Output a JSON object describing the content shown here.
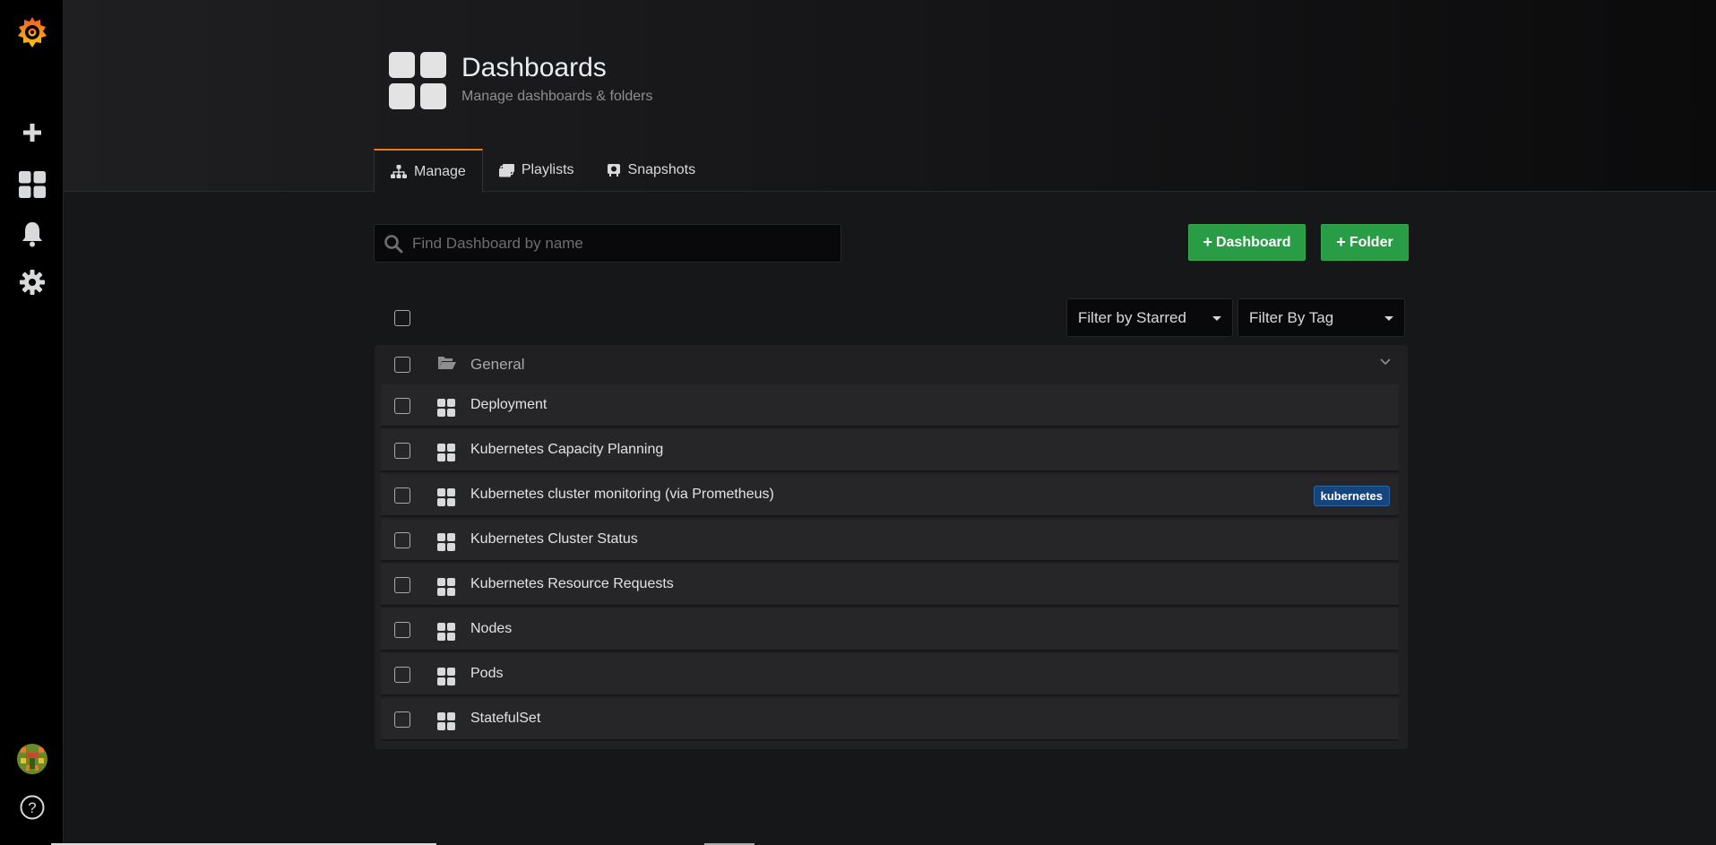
{
  "sidebar": {
    "logo": "grafana-logo",
    "items": [
      {
        "name": "create",
        "icon": "plus-icon"
      },
      {
        "name": "dashboards",
        "icon": "dashboards-icon"
      },
      {
        "name": "alerting",
        "icon": "bell-icon"
      },
      {
        "name": "configuration",
        "icon": "gear-icon"
      }
    ],
    "bottom": [
      {
        "name": "profile",
        "icon": "avatar"
      },
      {
        "name": "help",
        "icon": "question-icon"
      }
    ]
  },
  "header": {
    "title": "Dashboards",
    "subtitle": "Manage dashboards & folders",
    "tabs": [
      {
        "label": "Manage",
        "active": true,
        "icon": "sitemap-icon"
      },
      {
        "label": "Playlists",
        "active": false,
        "icon": "playlist-icon"
      },
      {
        "label": "Snapshots",
        "active": false,
        "icon": "camera-icon"
      }
    ]
  },
  "toolbar": {
    "search_placeholder": "Find Dashboard by name",
    "search_value": "",
    "new_dashboard_label": "Dashboard",
    "new_folder_label": "Folder"
  },
  "filters": {
    "starred_label": "Filter by Starred",
    "tag_label": "Filter By Tag"
  },
  "folder": {
    "name": "General",
    "items": [
      {
        "name": "Deployment",
        "tags": []
      },
      {
        "name": "Kubernetes Capacity Planning",
        "tags": []
      },
      {
        "name": "Kubernetes cluster monitoring (via Prometheus)",
        "tags": [
          "kubernetes"
        ]
      },
      {
        "name": "Kubernetes Cluster Status",
        "tags": []
      },
      {
        "name": "Kubernetes Resource Requests",
        "tags": []
      },
      {
        "name": "Nodes",
        "tags": []
      },
      {
        "name": "Pods",
        "tags": []
      },
      {
        "name": "StatefulSet",
        "tags": []
      }
    ]
  },
  "colors": {
    "accent": "#eb7b18",
    "primary_button": "#299c46",
    "tag": "#15457c"
  }
}
